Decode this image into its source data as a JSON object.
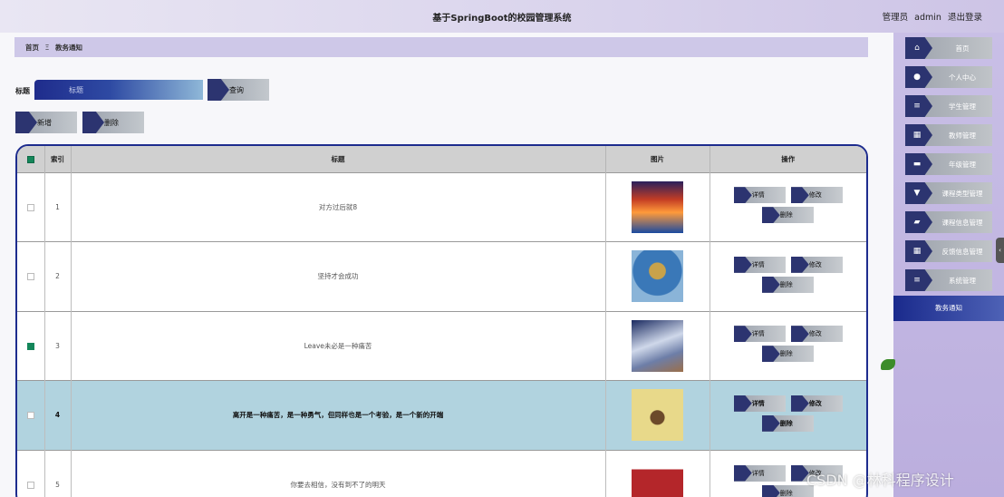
{
  "header": {
    "site_title": "基于SpringBoot的校园管理系统",
    "user_role": "管理员",
    "username": "admin",
    "logout": "退出登录"
  },
  "breadcrumb": {
    "home": "首页",
    "separator": "Ξ",
    "current": "教务通知"
  },
  "search": {
    "label": "标题",
    "placeholder": "标题",
    "button": "查询"
  },
  "actions": {
    "add": "新增",
    "delete": "删除"
  },
  "table": {
    "columns": {
      "index": "索引",
      "title": "标题",
      "image": "图片",
      "ops": "操作"
    },
    "rows": [
      {
        "index": "1",
        "title": "对方过后就8",
        "checked": false
      },
      {
        "index": "2",
        "title": "坚持才会成功",
        "checked": false
      },
      {
        "index": "3",
        "title": "Leave未必是一种痛苦",
        "checked": true
      },
      {
        "index": "4",
        "title": "离开是一种痛苦，是一种勇气，但同样也是一个考验，是一个新的开端",
        "checked": false,
        "hover": true
      },
      {
        "index": "5",
        "title": "你要去相信，没有到不了的明天",
        "checked": false
      }
    ],
    "op_labels": {
      "detail": "详情",
      "edit": "修改",
      "delete": "删除"
    }
  },
  "sidebar": {
    "items": [
      {
        "label": "首页",
        "icon": "home-icon"
      },
      {
        "label": "个人中心",
        "icon": "user-icon"
      },
      {
        "label": "学生管理",
        "icon": "list-icon"
      },
      {
        "label": "教师管理",
        "icon": "grid-icon"
      },
      {
        "label": "年级管理",
        "icon": "chat-icon"
      },
      {
        "label": "课程类型管理",
        "icon": "funnel-icon"
      },
      {
        "label": "课程信息管理",
        "icon": "ticket-icon"
      },
      {
        "label": "反馈信息管理",
        "icon": "grid-icon"
      },
      {
        "label": "系统管理",
        "icon": "list-icon"
      }
    ],
    "active": "教务通知"
  },
  "watermark": "CSDN @林科程序设计",
  "colors": {
    "accent": "#1d2c8e",
    "sidebar": "#c9bfe6",
    "checkbox": "#14865a",
    "row_highlight": "#b1d3df"
  }
}
